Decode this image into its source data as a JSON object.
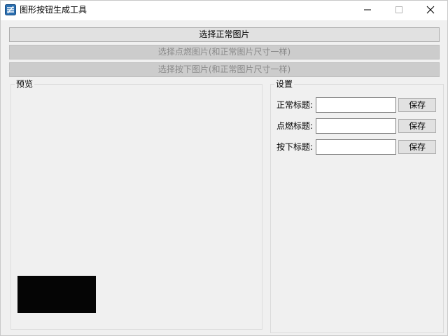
{
  "window": {
    "title": "图形按钮生成工具",
    "icon": "app-icon",
    "controls": {
      "minimize": "minimize-icon",
      "maximize": "maximize-icon",
      "close": "close-icon"
    }
  },
  "buttons": {
    "select_normal": "选择正常图片",
    "select_hover": "选择点燃图片(和正常图片尺寸一样)",
    "select_pressed": "选择按下图片(和正常图片尺寸一样)"
  },
  "preview": {
    "label": "预览",
    "box_color": "#050505"
  },
  "settings": {
    "label": "设置",
    "rows": [
      {
        "label": "正常标题:",
        "value": "",
        "save_label": "保存"
      },
      {
        "label": "点燃标题:",
        "value": "",
        "save_label": "保存"
      },
      {
        "label": "按下标题:",
        "value": "",
        "save_label": "保存"
      }
    ]
  },
  "colors": {
    "window_bg": "#f0f0f0",
    "titlebar_bg": "#ffffff",
    "disabled_text": "#8a8a8a"
  }
}
